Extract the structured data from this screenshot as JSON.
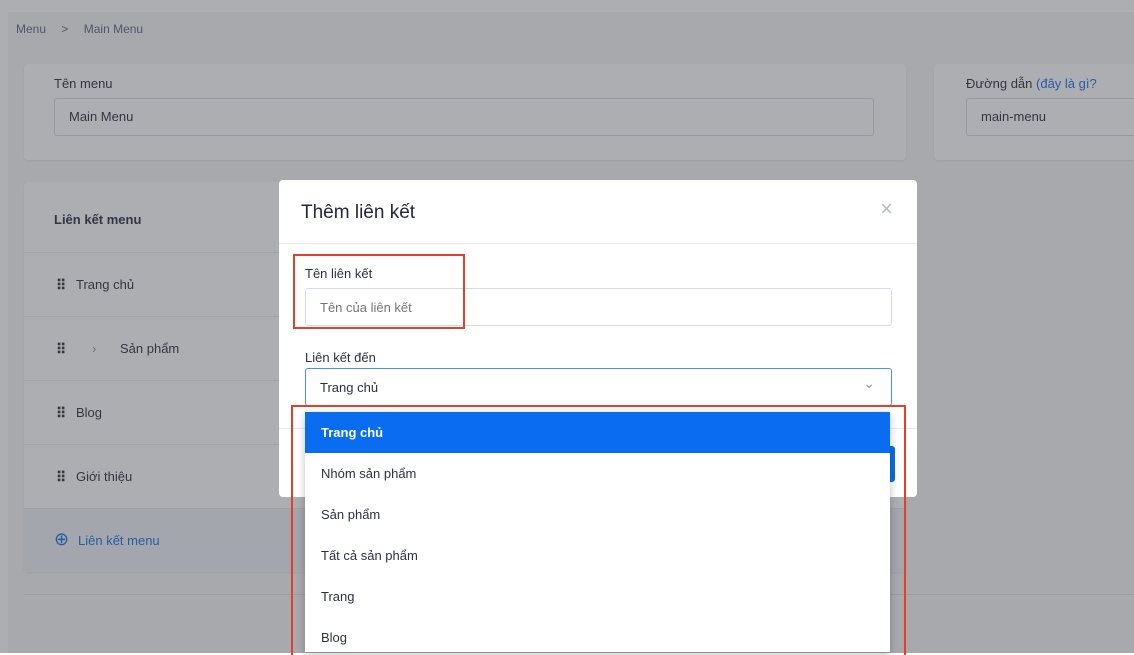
{
  "breadcrumb": {
    "root": "Menu",
    "separator": ">",
    "current": "Main Menu"
  },
  "menu_name": {
    "label": "Tên menu",
    "value": "Main Menu"
  },
  "path": {
    "label": "Đường dẫn",
    "help_link": "(đây là gì?",
    "value": "main-menu"
  },
  "links": {
    "header": "Liên kết menu",
    "drag_handle": "⠿",
    "items": [
      {
        "label": "Trang chủ",
        "expand": ""
      },
      {
        "label": "Sản phẩm",
        "expand": "›"
      },
      {
        "label": "Blog",
        "expand": ""
      },
      {
        "label": "Giới thiệu",
        "expand": ""
      }
    ],
    "add_icon": "⊕",
    "add_label": "Liên kết menu"
  },
  "modal": {
    "title": "Thêm liên kết",
    "close_icon": "×",
    "link_name": {
      "label": "Tên liên kết",
      "placeholder": "Tên của liên kết"
    },
    "link_to": {
      "label": "Liên kết đến",
      "value": "Trang chủ",
      "chevron": "⌄"
    },
    "options": [
      "Trang chủ",
      "Nhóm sản phẩm",
      "Sản phẩm",
      "Tất cả sản phẩm",
      "Trang",
      "Blog"
    ],
    "selected_index": 0
  },
  "colors": {
    "accent": "#0a6cf0",
    "highlight": "#e0412b",
    "link": "#1a73e8"
  }
}
